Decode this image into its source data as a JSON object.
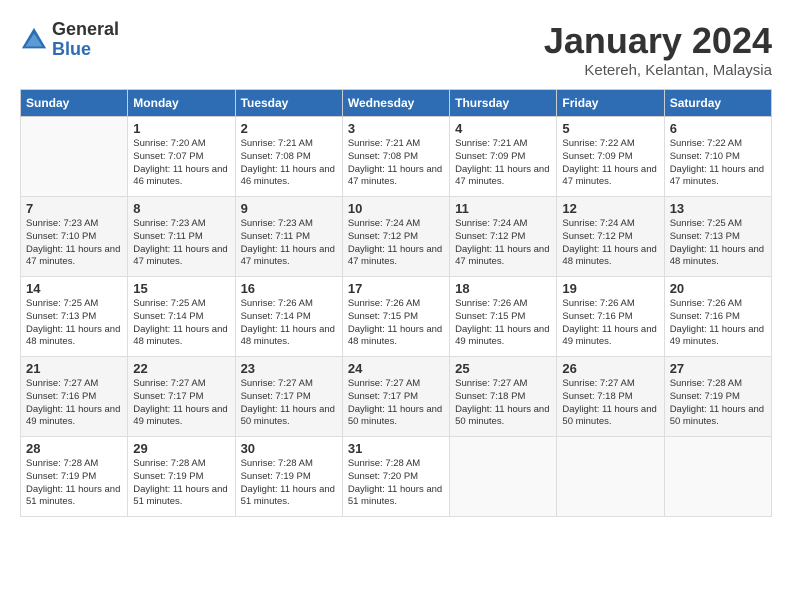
{
  "logo": {
    "general": "General",
    "blue": "Blue"
  },
  "title": "January 2024",
  "location": "Ketereh, Kelantan, Malaysia",
  "days_of_week": [
    "Sunday",
    "Monday",
    "Tuesday",
    "Wednesday",
    "Thursday",
    "Friday",
    "Saturday"
  ],
  "weeks": [
    [
      {
        "day": "",
        "sunrise": "",
        "sunset": "",
        "daylight": ""
      },
      {
        "day": "1",
        "sunrise": "Sunrise: 7:20 AM",
        "sunset": "Sunset: 7:07 PM",
        "daylight": "Daylight: 11 hours and 46 minutes."
      },
      {
        "day": "2",
        "sunrise": "Sunrise: 7:21 AM",
        "sunset": "Sunset: 7:08 PM",
        "daylight": "Daylight: 11 hours and 46 minutes."
      },
      {
        "day": "3",
        "sunrise": "Sunrise: 7:21 AM",
        "sunset": "Sunset: 7:08 PM",
        "daylight": "Daylight: 11 hours and 47 minutes."
      },
      {
        "day": "4",
        "sunrise": "Sunrise: 7:21 AM",
        "sunset": "Sunset: 7:09 PM",
        "daylight": "Daylight: 11 hours and 47 minutes."
      },
      {
        "day": "5",
        "sunrise": "Sunrise: 7:22 AM",
        "sunset": "Sunset: 7:09 PM",
        "daylight": "Daylight: 11 hours and 47 minutes."
      },
      {
        "day": "6",
        "sunrise": "Sunrise: 7:22 AM",
        "sunset": "Sunset: 7:10 PM",
        "daylight": "Daylight: 11 hours and 47 minutes."
      }
    ],
    [
      {
        "day": "7",
        "sunrise": "Sunrise: 7:23 AM",
        "sunset": "Sunset: 7:10 PM",
        "daylight": "Daylight: 11 hours and 47 minutes."
      },
      {
        "day": "8",
        "sunrise": "Sunrise: 7:23 AM",
        "sunset": "Sunset: 7:11 PM",
        "daylight": "Daylight: 11 hours and 47 minutes."
      },
      {
        "day": "9",
        "sunrise": "Sunrise: 7:23 AM",
        "sunset": "Sunset: 7:11 PM",
        "daylight": "Daylight: 11 hours and 47 minutes."
      },
      {
        "day": "10",
        "sunrise": "Sunrise: 7:24 AM",
        "sunset": "Sunset: 7:12 PM",
        "daylight": "Daylight: 11 hours and 47 minutes."
      },
      {
        "day": "11",
        "sunrise": "Sunrise: 7:24 AM",
        "sunset": "Sunset: 7:12 PM",
        "daylight": "Daylight: 11 hours and 47 minutes."
      },
      {
        "day": "12",
        "sunrise": "Sunrise: 7:24 AM",
        "sunset": "Sunset: 7:12 PM",
        "daylight": "Daylight: 11 hours and 48 minutes."
      },
      {
        "day": "13",
        "sunrise": "Sunrise: 7:25 AM",
        "sunset": "Sunset: 7:13 PM",
        "daylight": "Daylight: 11 hours and 48 minutes."
      }
    ],
    [
      {
        "day": "14",
        "sunrise": "Sunrise: 7:25 AM",
        "sunset": "Sunset: 7:13 PM",
        "daylight": "Daylight: 11 hours and 48 minutes."
      },
      {
        "day": "15",
        "sunrise": "Sunrise: 7:25 AM",
        "sunset": "Sunset: 7:14 PM",
        "daylight": "Daylight: 11 hours and 48 minutes."
      },
      {
        "day": "16",
        "sunrise": "Sunrise: 7:26 AM",
        "sunset": "Sunset: 7:14 PM",
        "daylight": "Daylight: 11 hours and 48 minutes."
      },
      {
        "day": "17",
        "sunrise": "Sunrise: 7:26 AM",
        "sunset": "Sunset: 7:15 PM",
        "daylight": "Daylight: 11 hours and 48 minutes."
      },
      {
        "day": "18",
        "sunrise": "Sunrise: 7:26 AM",
        "sunset": "Sunset: 7:15 PM",
        "daylight": "Daylight: 11 hours and 49 minutes."
      },
      {
        "day": "19",
        "sunrise": "Sunrise: 7:26 AM",
        "sunset": "Sunset: 7:16 PM",
        "daylight": "Daylight: 11 hours and 49 minutes."
      },
      {
        "day": "20",
        "sunrise": "Sunrise: 7:26 AM",
        "sunset": "Sunset: 7:16 PM",
        "daylight": "Daylight: 11 hours and 49 minutes."
      }
    ],
    [
      {
        "day": "21",
        "sunrise": "Sunrise: 7:27 AM",
        "sunset": "Sunset: 7:16 PM",
        "daylight": "Daylight: 11 hours and 49 minutes."
      },
      {
        "day": "22",
        "sunrise": "Sunrise: 7:27 AM",
        "sunset": "Sunset: 7:17 PM",
        "daylight": "Daylight: 11 hours and 49 minutes."
      },
      {
        "day": "23",
        "sunrise": "Sunrise: 7:27 AM",
        "sunset": "Sunset: 7:17 PM",
        "daylight": "Daylight: 11 hours and 50 minutes."
      },
      {
        "day": "24",
        "sunrise": "Sunrise: 7:27 AM",
        "sunset": "Sunset: 7:17 PM",
        "daylight": "Daylight: 11 hours and 50 minutes."
      },
      {
        "day": "25",
        "sunrise": "Sunrise: 7:27 AM",
        "sunset": "Sunset: 7:18 PM",
        "daylight": "Daylight: 11 hours and 50 minutes."
      },
      {
        "day": "26",
        "sunrise": "Sunrise: 7:27 AM",
        "sunset": "Sunset: 7:18 PM",
        "daylight": "Daylight: 11 hours and 50 minutes."
      },
      {
        "day": "27",
        "sunrise": "Sunrise: 7:28 AM",
        "sunset": "Sunset: 7:19 PM",
        "daylight": "Daylight: 11 hours and 50 minutes."
      }
    ],
    [
      {
        "day": "28",
        "sunrise": "Sunrise: 7:28 AM",
        "sunset": "Sunset: 7:19 PM",
        "daylight": "Daylight: 11 hours and 51 minutes."
      },
      {
        "day": "29",
        "sunrise": "Sunrise: 7:28 AM",
        "sunset": "Sunset: 7:19 PM",
        "daylight": "Daylight: 11 hours and 51 minutes."
      },
      {
        "day": "30",
        "sunrise": "Sunrise: 7:28 AM",
        "sunset": "Sunset: 7:19 PM",
        "daylight": "Daylight: 11 hours and 51 minutes."
      },
      {
        "day": "31",
        "sunrise": "Sunrise: 7:28 AM",
        "sunset": "Sunset: 7:20 PM",
        "daylight": "Daylight: 11 hours and 51 minutes."
      },
      {
        "day": "",
        "sunrise": "",
        "sunset": "",
        "daylight": ""
      },
      {
        "day": "",
        "sunrise": "",
        "sunset": "",
        "daylight": ""
      },
      {
        "day": "",
        "sunrise": "",
        "sunset": "",
        "daylight": ""
      }
    ]
  ]
}
